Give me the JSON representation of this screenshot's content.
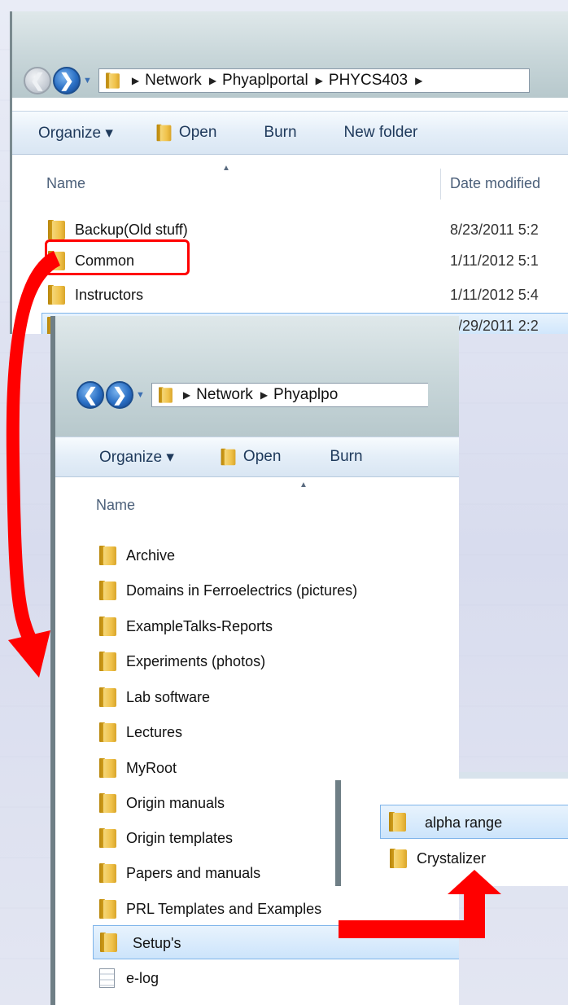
{
  "window_back": {
    "breadcrumb": [
      "Network",
      "Phyaplportal",
      "PHYCS403"
    ],
    "toolbar": {
      "organize": "Organize ▾",
      "open": "Open",
      "burn": "Burn",
      "new_folder": "New folder"
    },
    "columns": {
      "name": "Name",
      "date": "Date modified"
    },
    "rows": [
      {
        "name": "Backup(Old stuff)",
        "date": "8/23/2011 5:2"
      },
      {
        "name": "Common",
        "date": "1/11/2012 5:1"
      },
      {
        "name": "Instructors",
        "date": "1/11/2012 5:4"
      },
      {
        "name": "",
        "date": "9/29/2011 2:2"
      }
    ]
  },
  "window_front": {
    "breadcrumb": [
      "Network",
      "Phyaplpo"
    ],
    "toolbar": {
      "organize": "Organize ▾",
      "open": "Open",
      "burn": "Burn"
    },
    "columns": {
      "name": "Name"
    },
    "rows": [
      {
        "name": "Archive"
      },
      {
        "name": "Domains in Ferroelectrics (pictures)"
      },
      {
        "name": "ExampleTalks-Reports"
      },
      {
        "name": "Experiments (photos)"
      },
      {
        "name": "Lab software"
      },
      {
        "name": "Lectures"
      },
      {
        "name": "MyRoot"
      },
      {
        "name": "Origin manuals"
      },
      {
        "name": "Origin templates"
      },
      {
        "name": "Papers and manuals"
      },
      {
        "name": "PRL Templates and Examples"
      },
      {
        "name": "Setup's"
      },
      {
        "name": "e-log"
      }
    ]
  },
  "window_inner": {
    "rows": [
      {
        "name": "alpha range"
      },
      {
        "name": "Crystalizer"
      }
    ]
  },
  "colors": {
    "highlight": "#ff0000",
    "selection": "#cce4fb"
  }
}
